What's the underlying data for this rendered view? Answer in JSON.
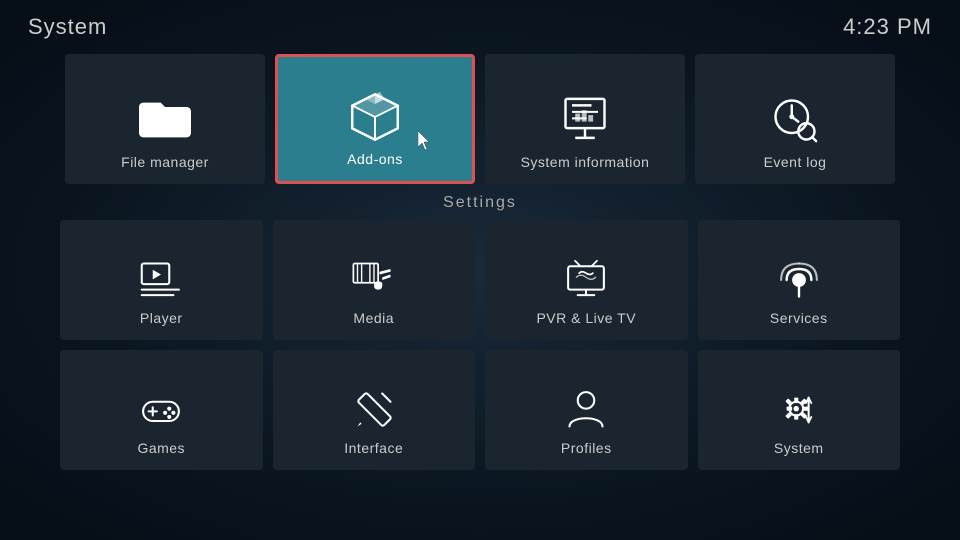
{
  "header": {
    "title": "System",
    "time": "4:23 PM"
  },
  "top_row": [
    {
      "id": "file-manager",
      "label": "File manager",
      "icon": "folder",
      "active": false
    },
    {
      "id": "add-ons",
      "label": "Add-ons",
      "icon": "box",
      "active": true
    },
    {
      "id": "system-information",
      "label": "System information",
      "icon": "presentation",
      "active": false
    },
    {
      "id": "event-log",
      "label": "Event log",
      "icon": "clock-search",
      "active": false
    }
  ],
  "section_label": "Settings",
  "settings": [
    {
      "id": "player",
      "label": "Player",
      "icon": "play"
    },
    {
      "id": "media",
      "label": "Media",
      "icon": "media"
    },
    {
      "id": "pvr-live-tv",
      "label": "PVR & Live TV",
      "icon": "tv"
    },
    {
      "id": "services",
      "label": "Services",
      "icon": "podcast"
    },
    {
      "id": "games",
      "label": "Games",
      "icon": "gamepad"
    },
    {
      "id": "interface",
      "label": "Interface",
      "icon": "pencil"
    },
    {
      "id": "profiles",
      "label": "Profiles",
      "icon": "person"
    },
    {
      "id": "system",
      "label": "System",
      "icon": "gear-fork"
    }
  ]
}
